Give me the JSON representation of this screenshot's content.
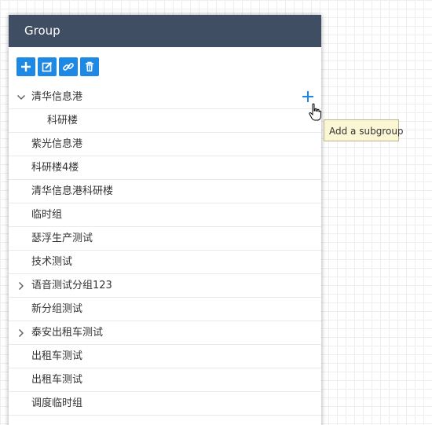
{
  "panel": {
    "title": "Group"
  },
  "toolbar": {
    "buttons": [
      {
        "icon": "plus-icon",
        "name": "add-group-button"
      },
      {
        "icon": "edit-icon",
        "name": "edit-group-button"
      },
      {
        "icon": "link-icon",
        "name": "link-group-button"
      },
      {
        "icon": "trash-icon",
        "name": "delete-group-button"
      }
    ]
  },
  "tree": {
    "items": [
      {
        "label": "清华信息港",
        "expanded": true,
        "has_children": true
      },
      {
        "label": "科研楼",
        "child": true
      },
      {
        "label": "紫光信息港"
      },
      {
        "label": "科研楼4楼"
      },
      {
        "label": "清华信息港科研楼"
      },
      {
        "label": "临时组"
      },
      {
        "label": "瑟浮生产测试"
      },
      {
        "label": "技术测试"
      },
      {
        "label": "语音测试分组123",
        "has_children": true,
        "expanded": false
      },
      {
        "label": "新分组测试"
      },
      {
        "label": "泰安出租车测试",
        "has_children": true,
        "expanded": false
      },
      {
        "label": "出租车测试"
      },
      {
        "label": "出租车测试"
      },
      {
        "label": "调度临时组"
      }
    ]
  },
  "tooltip": {
    "text": "Add a subgroup"
  },
  "colors": {
    "header_bg": "#3f4e62",
    "accent": "#1e88e5",
    "tooltip_bg": "#fbf7d5"
  }
}
